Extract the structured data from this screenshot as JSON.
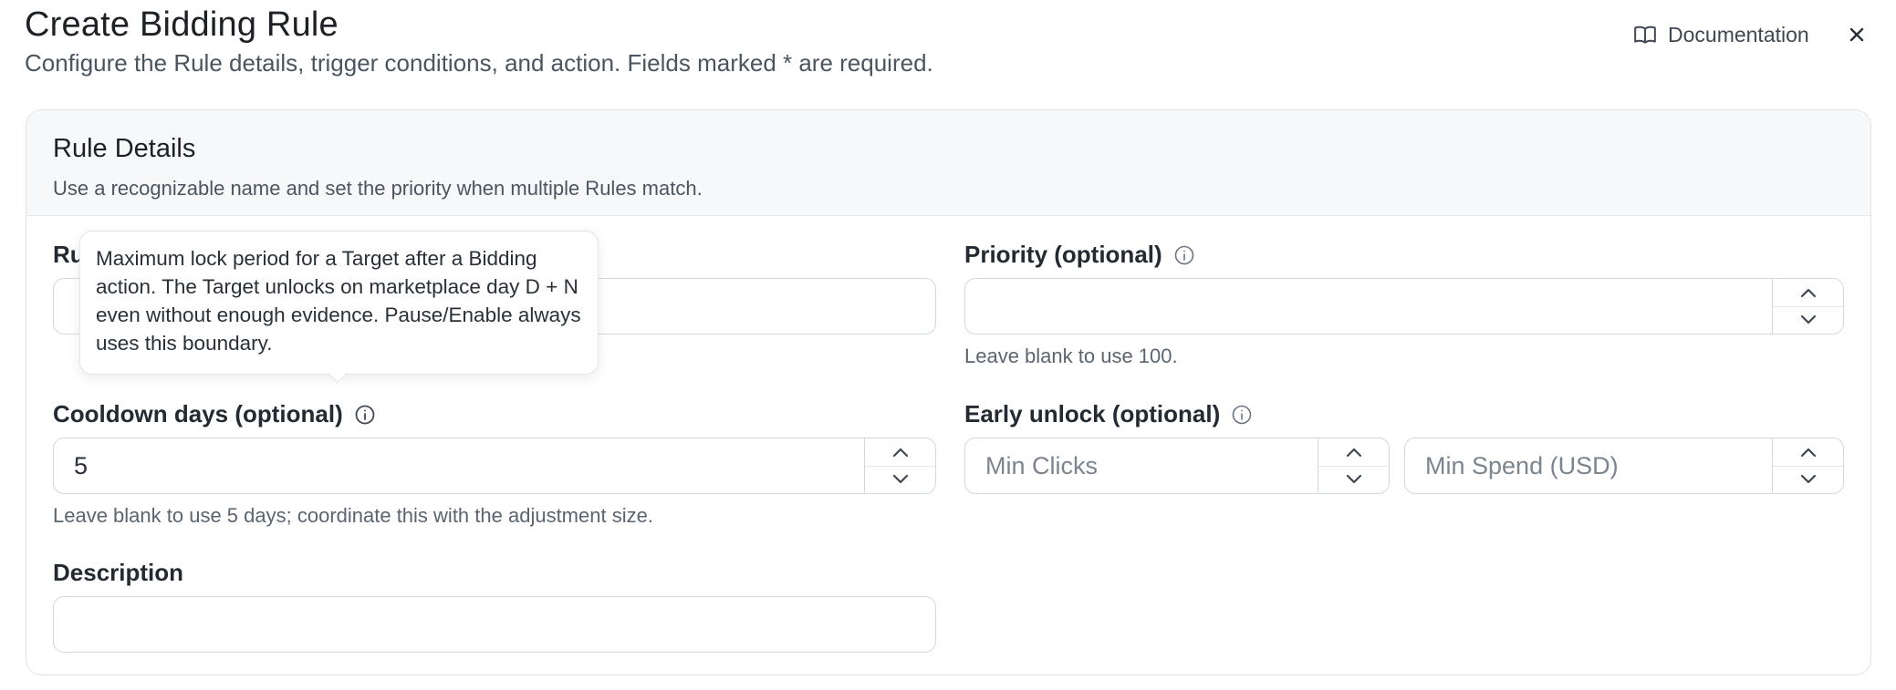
{
  "header": {
    "title": "Create Bidding Rule",
    "subtitle": "Configure the Rule details, trigger conditions, and action. Fields marked * are required.",
    "documentation_label": "Documentation",
    "close_icon": "close-icon",
    "documentation_icon": "book-icon"
  },
  "section": {
    "title": "Rule Details",
    "description": "Use a recognizable name and set the priority when multiple Rules match."
  },
  "fields": {
    "rule_name": {
      "label_visible": "Ru",
      "value": ""
    },
    "priority": {
      "label": "Priority (optional)",
      "value": "",
      "hint": "Leave blank to use 100."
    },
    "cooldown": {
      "label": "Cooldown days (optional)",
      "value": "5",
      "hint": "Leave blank to use 5 days; coordinate this with the adjustment size."
    },
    "early_unlock": {
      "label": "Early unlock (optional)",
      "min_clicks_placeholder": "Min Clicks",
      "min_spend_placeholder": "Min Spend (USD)"
    },
    "description": {
      "label": "Description",
      "value": ""
    }
  },
  "tooltip": {
    "text": "Maximum lock period for a Target after a Bidding action. The Target unlocks on marketplace day D + N even without enough evidence. Pause/Enable always uses this boundary."
  }
}
